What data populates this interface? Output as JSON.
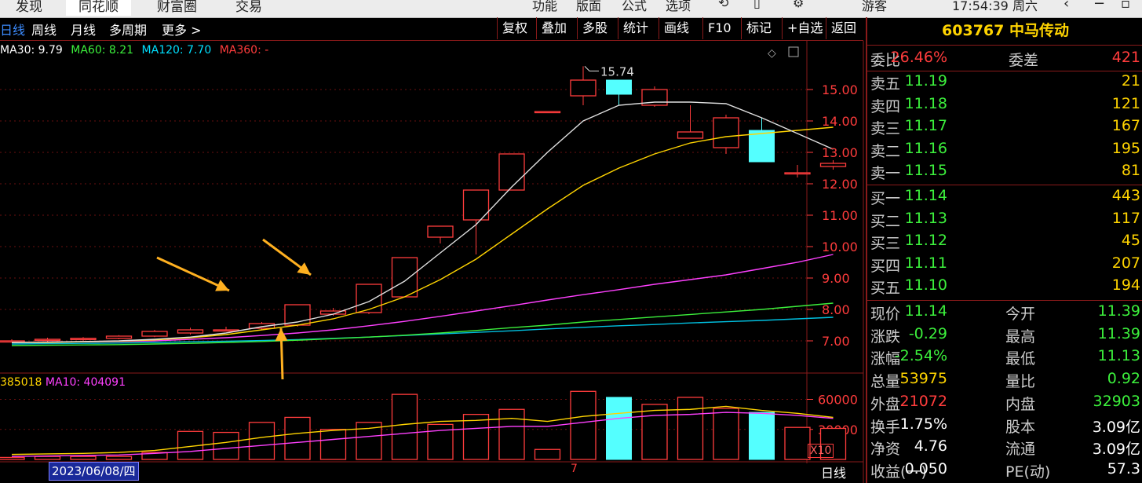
{
  "topbar": {
    "tabs": [
      "发现",
      "同花顺",
      "财富圈",
      "交易"
    ],
    "menus": [
      "功能",
      "版面",
      "公式",
      "选项"
    ],
    "icons": [
      "refresh-icon",
      "save-icon",
      "settings-icon"
    ],
    "guest": "游客",
    "clock": "17:54:39 周六"
  },
  "toolbar": {
    "periods": [
      "日线",
      "周线",
      "月线",
      "多周期",
      "更多 >"
    ],
    "buttons": [
      "复权",
      "叠加",
      "多股",
      "统计",
      "画线",
      "F10",
      "标记",
      "+自选",
      "返回"
    ]
  },
  "ma_legend": [
    {
      "label": "MA30: 9.79",
      "color": "#ffffff"
    },
    {
      "label": "MA60: 8.21",
      "color": "#3cf03c"
    },
    {
      "label": "MA120: 7.70",
      "color": "#00e0ff"
    },
    {
      "label": "MA360: -",
      "color": "#ff3c3c"
    }
  ],
  "vol_legend": [
    {
      "label": "385018",
      "color": "#ffd400"
    },
    {
      "label": "MA10: 404091",
      "color": "#ff40ff"
    }
  ],
  "price_axis": [
    "15.00",
    "14.00",
    "13.00",
    "12.00",
    "11.00",
    "10.00",
    "9.00",
    "8.00",
    "7.00"
  ],
  "vol_axis": [
    "60000",
    "30000"
  ],
  "high_label": "15.74",
  "date_label": "2023/06/08/四",
  "bottom_tick": "7",
  "x10": "X10",
  "period_label": "日线",
  "quote": {
    "title": "603767 中马传动",
    "ratio": {
      "label": "委比",
      "value": "26.46%",
      "label2": "委差",
      "value2": "421"
    },
    "sells": [
      {
        "label": "卖五",
        "price": "11.19",
        "vol": "21"
      },
      {
        "label": "卖四",
        "price": "11.18",
        "vol": "121"
      },
      {
        "label": "卖三",
        "price": "11.17",
        "vol": "167"
      },
      {
        "label": "卖二",
        "price": "11.16",
        "vol": "195"
      },
      {
        "label": "卖一",
        "price": "11.15",
        "vol": "81"
      }
    ],
    "buys": [
      {
        "label": "买一",
        "price": "11.14",
        "vol": "443"
      },
      {
        "label": "买二",
        "price": "11.13",
        "vol": "117"
      },
      {
        "label": "买三",
        "price": "11.12",
        "vol": "45"
      },
      {
        "label": "买四",
        "price": "11.11",
        "vol": "207"
      },
      {
        "label": "买五",
        "price": "11.10",
        "vol": "194"
      }
    ],
    "stats": [
      {
        "l1": "现价",
        "v1": "11.14",
        "c1": "green",
        "l2": "今开",
        "v2": "11.39",
        "c2": "green"
      },
      {
        "l1": "涨跌",
        "v1": "-0.29",
        "c1": "green",
        "l2": "最高",
        "v2": "11.39",
        "c2": "green"
      },
      {
        "l1": "涨幅",
        "v1": "-2.54%",
        "c1": "green",
        "l2": "最低",
        "v2": "11.13",
        "c2": "green"
      },
      {
        "l1": "总量",
        "v1": "53975",
        "c1": "yellow",
        "l2": "量比",
        "v2": "0.92",
        "c2": "green"
      },
      {
        "l1": "外盘",
        "v1": "21072",
        "c1": "red",
        "l2": "内盘",
        "v2": "32903",
        "c2": "green"
      },
      {
        "l1": "换手",
        "v1": "1.75%",
        "c1": "white",
        "l2": "股本",
        "v2": "3.09亿",
        "c2": "white"
      },
      {
        "l1": "净资",
        "v1": "4.76",
        "c1": "white",
        "l2": "流通",
        "v2": "3.09亿",
        "c2": "white"
      },
      {
        "l1": "收益(一)",
        "v1": "0.050",
        "c1": "white",
        "l2": "PE(动)",
        "v2": "57.3",
        "c2": "white"
      }
    ]
  },
  "chart_data": {
    "type": "candlestick",
    "ylim": [
      6.4,
      16.4
    ],
    "candles": [
      {
        "o": 7.0,
        "c": 7.0,
        "h": 7.05,
        "l": 6.95
      },
      {
        "o": 7.02,
        "c": 7.05,
        "h": 7.1,
        "l": 6.95
      },
      {
        "o": 7.05,
        "c": 7.08,
        "h": 7.12,
        "l": 7.0
      },
      {
        "o": 7.08,
        "c": 7.15,
        "h": 7.18,
        "l": 7.05
      },
      {
        "o": 7.15,
        "c": 7.3,
        "h": 7.35,
        "l": 7.12
      },
      {
        "o": 7.25,
        "c": 7.35,
        "h": 7.42,
        "l": 7.2
      },
      {
        "o": 7.35,
        "c": 7.35,
        "h": 7.45,
        "l": 7.3
      },
      {
        "o": 7.4,
        "c": 7.55,
        "h": 7.6,
        "l": 7.35
      },
      {
        "o": 7.5,
        "c": 8.15,
        "h": 8.15,
        "l": 7.45
      },
      {
        "o": 7.85,
        "c": 7.95,
        "h": 8.05,
        "l": 7.8
      },
      {
        "o": 7.9,
        "c": 8.8,
        "h": 8.8,
        "l": 7.85
      },
      {
        "o": 8.4,
        "c": 9.65,
        "h": 9.65,
        "l": 8.4
      },
      {
        "o": 10.3,
        "c": 10.65,
        "h": 10.65,
        "l": 10.1
      },
      {
        "o": 10.85,
        "c": 11.8,
        "h": 11.8,
        "l": 9.75
      },
      {
        "o": 11.8,
        "c": 12.95,
        "h": 12.95,
        "l": 11.8
      },
      {
        "o": 14.3,
        "c": 14.3,
        "h": 14.3,
        "l": 14.3
      },
      {
        "o": 14.8,
        "c": 15.3,
        "h": 15.74,
        "l": 14.5
      },
      {
        "o": 15.3,
        "c": 14.85,
        "h": 15.3,
        "l": 14.5
      },
      {
        "o": 14.5,
        "c": 15.0,
        "h": 15.1,
        "l": 14.45
      },
      {
        "o": 13.45,
        "c": 13.65,
        "h": 14.5,
        "l": 13.45
      },
      {
        "o": 13.15,
        "c": 14.1,
        "h": 14.2,
        "l": 12.95
      },
      {
        "o": 13.7,
        "c": 12.7,
        "h": 14.1,
        "l": 12.7
      },
      {
        "o": 12.35,
        "c": 12.35,
        "h": 12.6,
        "l": 12.2
      },
      {
        "o": 12.55,
        "c": 12.65,
        "h": 12.75,
        "l": 12.45
      }
    ],
    "ma_white": [
      6.95,
      6.96,
      6.98,
      7.0,
      7.05,
      7.12,
      7.25,
      7.45,
      7.6,
      7.85,
      8.25,
      8.9,
      9.8,
      10.7,
      11.9,
      13.0,
      14.0,
      14.5,
      14.6,
      14.6,
      14.55,
      14.1,
      13.6,
      13.1
    ],
    "ma_yellow": [
      6.95,
      6.95,
      6.97,
      6.99,
      7.03,
      7.1,
      7.2,
      7.35,
      7.5,
      7.7,
      8.0,
      8.4,
      8.95,
      9.6,
      10.4,
      11.2,
      11.95,
      12.5,
      12.95,
      13.3,
      13.5,
      13.6,
      13.7,
      13.8
    ],
    "ma_magenta": [
      6.95,
      6.96,
      6.97,
      6.98,
      7.0,
      7.05,
      7.1,
      7.17,
      7.25,
      7.35,
      7.48,
      7.62,
      7.78,
      7.95,
      8.12,
      8.3,
      8.47,
      8.63,
      8.8,
      8.95,
      9.1,
      9.3,
      9.5,
      9.75
    ],
    "ma_green": [
      6.85,
      6.86,
      6.87,
      6.88,
      6.9,
      6.92,
      6.95,
      6.98,
      7.02,
      7.07,
      7.12,
      7.18,
      7.25,
      7.33,
      7.42,
      7.5,
      7.6,
      7.68,
      7.76,
      7.84,
      7.92,
      8.0,
      8.1,
      8.2
    ],
    "ma_cyan": [
      6.9,
      6.91,
      6.92,
      6.93,
      6.95,
      6.97,
      6.99,
      7.01,
      7.04,
      7.08,
      7.12,
      7.17,
      7.22,
      7.27,
      7.32,
      7.38,
      7.43,
      7.48,
      7.52,
      7.57,
      7.61,
      7.65,
      7.7,
      7.75
    ],
    "volume": {
      "ylim": [
        0,
        80000
      ],
      "values": [
        2000,
        3000,
        3000,
        3000,
        7000,
        28000,
        27000,
        37000,
        42000,
        30000,
        37000,
        65000,
        35000,
        45000,
        50000,
        10000,
        68000,
        62000,
        55000,
        62000,
        51000,
        47000,
        32000,
        31000
      ],
      "up": [
        true,
        true,
        true,
        true,
        true,
        true,
        true,
        true,
        true,
        true,
        true,
        true,
        true,
        true,
        true,
        true,
        true,
        false,
        true,
        true,
        true,
        false,
        true,
        true
      ],
      "ma_yellow": [
        5000,
        5500,
        6000,
        7000,
        9000,
        13000,
        17000,
        22000,
        26000,
        29000,
        31000,
        35000,
        38000,
        39000,
        41000,
        38000,
        43000,
        46000,
        49000,
        50000,
        53000,
        49000,
        46000,
        42000
      ],
      "ma_magenta": [
        3000,
        3500,
        4000,
        4500,
        6000,
        8000,
        11000,
        14000,
        17000,
        20000,
        23000,
        26000,
        29000,
        31000,
        33000,
        33000,
        37000,
        41000,
        44000,
        45000,
        47000,
        46000,
        44000,
        41000
      ]
    }
  }
}
